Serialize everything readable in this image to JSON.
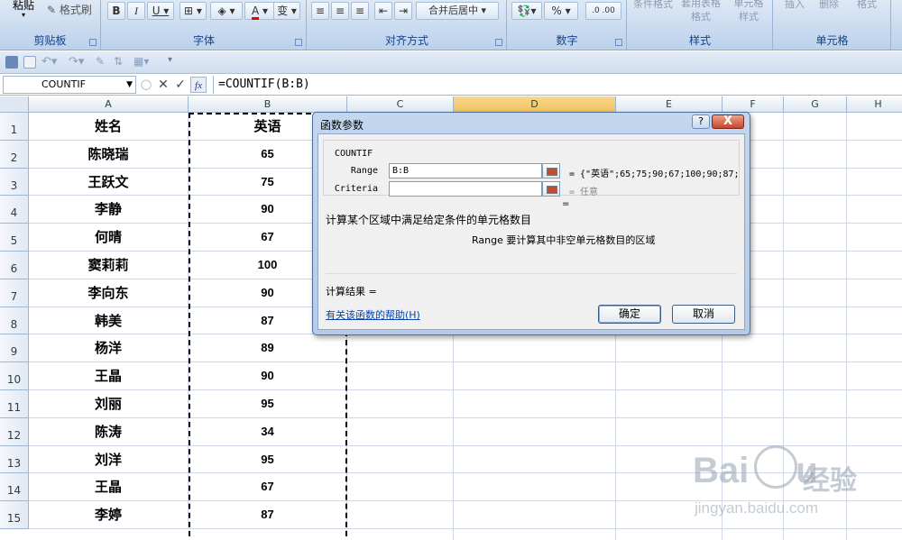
{
  "ribbon": {
    "paste_label": "粘贴",
    "format_painter_label": "格式刷",
    "group_clipboard": "剪贴板",
    "group_font": "字体",
    "group_alignment": "对齐方式",
    "group_number": "数字",
    "group_styles": "样式",
    "group_cells": "单元格",
    "merge_center_label": "合并后居中",
    "percent_label": "%",
    "conditional_format_label": "条件格式",
    "table_format_label": "套用表格格式",
    "cell_style_label": "单元格样式",
    "insert_label": "插入",
    "delete_label": "删除",
    "format_label": "格式"
  },
  "formula_bar": {
    "name_box": "COUNTIF",
    "formula": "=COUNTIF(B:B)",
    "fx_label": "fx"
  },
  "columns": [
    "A",
    "B",
    "C",
    "D",
    "E",
    "F",
    "G",
    "H"
  ],
  "selected_column": "D",
  "rows": [
    {
      "num": "1",
      "a": "姓名",
      "b": "英语"
    },
    {
      "num": "2",
      "a": "陈晓瑞",
      "b": "65"
    },
    {
      "num": "3",
      "a": "王跃文",
      "b": "75"
    },
    {
      "num": "4",
      "a": "李静",
      "b": "90"
    },
    {
      "num": "5",
      "a": "何晴",
      "b": "67"
    },
    {
      "num": "6",
      "a": "窦莉莉",
      "b": "100"
    },
    {
      "num": "7",
      "a": "李向东",
      "b": "90"
    },
    {
      "num": "8",
      "a": "韩美",
      "b": "87"
    },
    {
      "num": "9",
      "a": "杨洋",
      "b": "89"
    },
    {
      "num": "10",
      "a": "王晶",
      "b": "90"
    },
    {
      "num": "11",
      "a": "刘丽",
      "b": "95"
    },
    {
      "num": "12",
      "a": "陈涛",
      "b": "34"
    },
    {
      "num": "13",
      "a": "刘洋",
      "b": "95"
    },
    {
      "num": "14",
      "a": "王晶",
      "b": "67"
    },
    {
      "num": "15",
      "a": "李婷",
      "b": "87"
    }
  ],
  "dialog": {
    "title": "函数参数",
    "help_btn": "?",
    "close_btn": "X",
    "function_name": "COUNTIF",
    "range_label": "Range",
    "range_value": "B:B",
    "range_result": "= {\"英语\";65;75;90;67;100;90;87;",
    "criteria_label": "Criteria",
    "criteria_value": "",
    "criteria_result": "= 任意",
    "total_result": "=",
    "description": "计算某个区域中满足给定条件的单元格数目",
    "arg_description": "Range  要计算其中非空单元格数目的区域",
    "calc_result": "计算结果 =",
    "help_link": "有关该函数的帮助(H)",
    "ok_label": "确定",
    "cancel_label": "取消"
  },
  "watermark": {
    "logo": "Bai",
    "logo_tail": "u",
    "cn": "经验",
    "url": "jingyan.baidu.com"
  }
}
